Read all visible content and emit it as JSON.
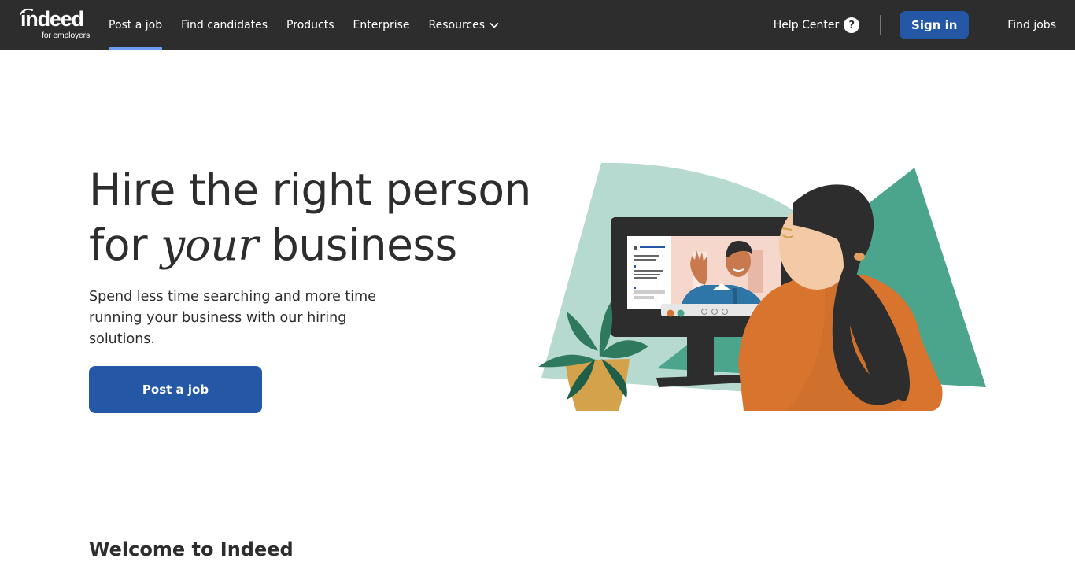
{
  "brand": {
    "logo_main": "indeed",
    "logo_sub": "for employers"
  },
  "nav": {
    "links": [
      "Post a job",
      "Find candidates",
      "Products",
      "Enterprise",
      "Resources"
    ],
    "help_center": "Help Center",
    "help_icon_glyph": "?",
    "sign_in": "Sign in",
    "find_jobs": "Find jobs"
  },
  "hero": {
    "title_line1": "Hire the right person",
    "title_line2_pre": "for ",
    "title_line2_em": "your",
    "title_line2_post": " business",
    "subtitle": "Spend less time searching and more time running your business with our hiring solutions.",
    "cta": "Post a job"
  },
  "welcome": {
    "heading": "Welcome to Indeed"
  },
  "colors": {
    "nav_bg": "#2d2d2d",
    "accent_blue": "#2557a7",
    "active_underline": "#6d9cf0",
    "illus_light_green": "#b6d9d0",
    "illus_dark_green": "#4ba58c",
    "illus_orange": "#d9742f"
  },
  "icons": {
    "help": "question-circle-icon",
    "resources_dropdown": "chevron-down-icon",
    "logo": "indeed-logo"
  }
}
